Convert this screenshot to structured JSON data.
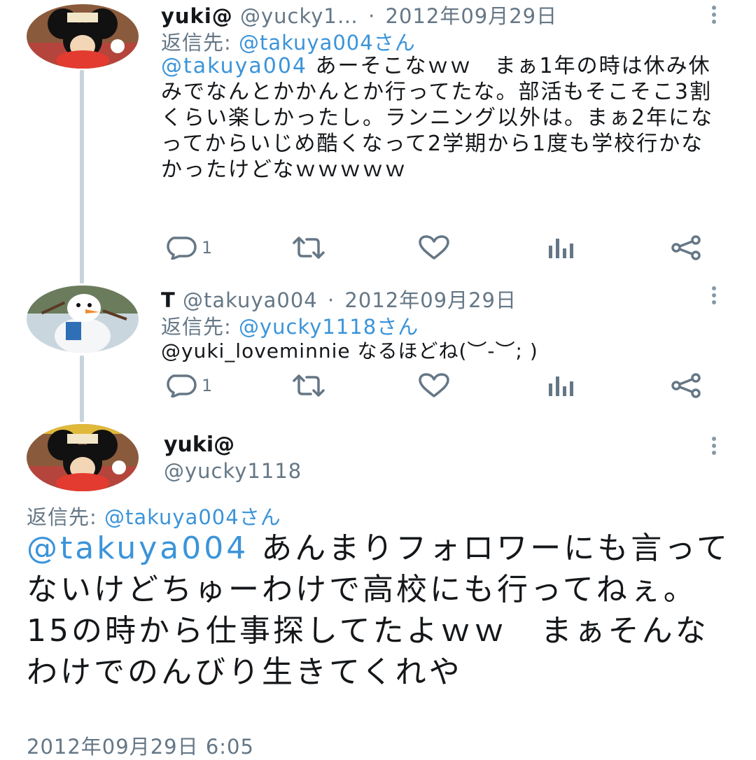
{
  "tweets": [
    {
      "display_name": "yuki@",
      "handle": "@yucky1…",
      "separator": "·",
      "date": "2012年09月29日",
      "reply_label": "返信先:",
      "reply_target": "@takuya004さん",
      "mention": "@takuya004",
      "text": " あーそこなｗｗ　まぁ1年の時は休み休みでなんとかかんとか行ってたな。部活もそこそこ3割くらい楽しかったし。ランニング以外は。まぁ2年になってからいじめ酷くなって2学期から1度も学校行かなかったけどなｗｗｗｗｗ",
      "reply_count": "1",
      "avatar_icon": "minnie-avatar"
    },
    {
      "display_name": "T",
      "handle": "@takuya004",
      "separator": "·",
      "date": "2012年09月29日",
      "reply_label": "返信先:",
      "reply_target": "@yucky1118さん",
      "text": "@yuki_loveminnie なるほどね(︶-︶; )",
      "reply_count": "1",
      "avatar_icon": "olaf-avatar"
    }
  ],
  "main_tweet": {
    "display_name": "yuki@",
    "handle": "@yucky1118",
    "reply_label": "返信先:",
    "reply_target": "@takuya004さん",
    "mention": "@takuya004",
    "text": " あんまりフォロワーにも言ってないけどちゅーわけで高校にも行ってねぇ。15の時から仕事探してたよｗｗ　まぁそんなわけでのんびり生きてくれや",
    "timestamp": "2012年09月29日 6:05",
    "avatar_icon": "minnie-avatar"
  },
  "icons": {
    "reply": "reply-icon",
    "retweet": "retweet-icon",
    "like": "heart-icon",
    "analytics": "analytics-icon",
    "share": "share-icon",
    "more": "more-vertical-icon"
  },
  "colors": {
    "link": "#3b94d9",
    "secondary_text": "#657786",
    "primary_text": "#14171a",
    "thread_line": "#c8d3db"
  }
}
